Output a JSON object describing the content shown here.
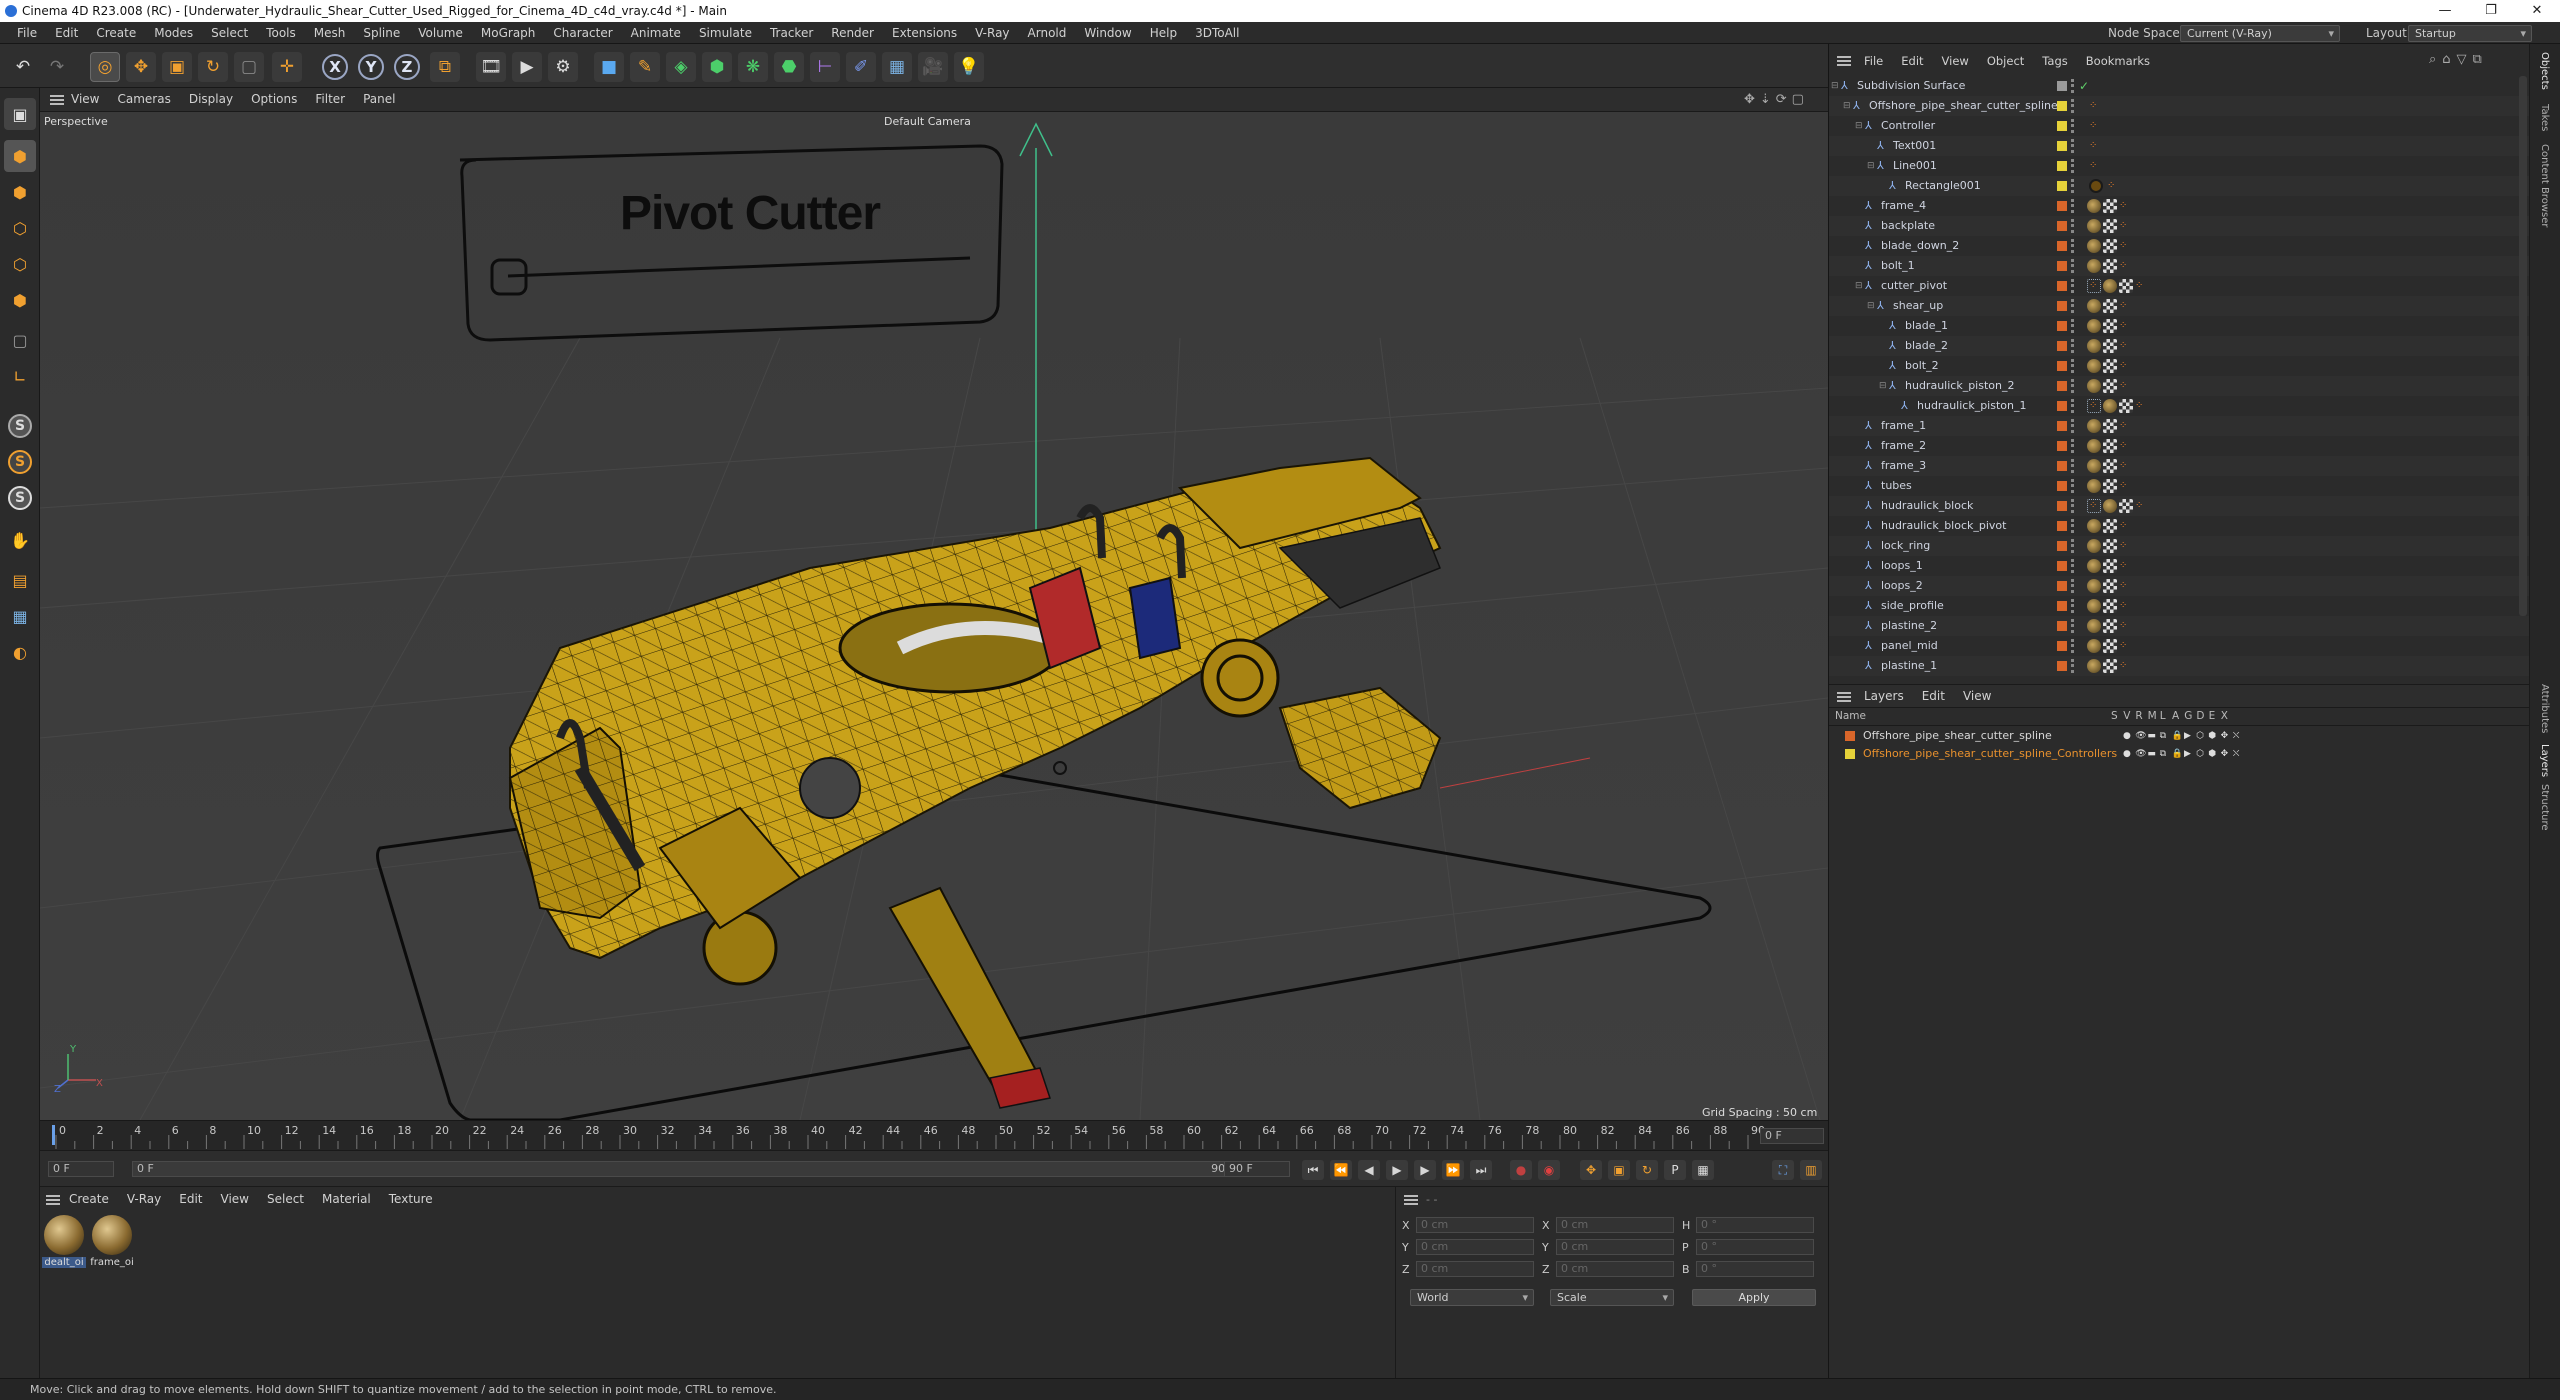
{
  "window": {
    "title": "Cinema 4D R23.008 (RC) - [Underwater_Hydraulic_Shear_Cutter_Used_Rigged_for_Cinema_4D_c4d_vray.c4d *] - Main"
  },
  "menubar": {
    "items": [
      "File",
      "Edit",
      "Create",
      "Modes",
      "Select",
      "Tools",
      "Mesh",
      "Spline",
      "Volume",
      "MoGraph",
      "Character",
      "Animate",
      "Simulate",
      "Tracker",
      "Render",
      "Extensions",
      "V-Ray",
      "Arnold",
      "Window",
      "Help",
      "3DToAll"
    ],
    "node_space_label": "Node Space:",
    "node_space_value": "Current (V-Ray)",
    "layout_label": "Layout:",
    "layout_value": "Startup"
  },
  "toolbar": {
    "axis_x": "X",
    "axis_y": "Y",
    "axis_z": "Z"
  },
  "viewport": {
    "menu": [
      "View",
      "Cameras",
      "Display",
      "Options",
      "Filter",
      "Panel"
    ],
    "projection": "Perspective",
    "camera": "Default Camera",
    "grid_spacing": "Grid Spacing : 50 cm",
    "overlay_text": "Pivot Cutter"
  },
  "timeline": {
    "ticks": [
      "0",
      "2",
      "4",
      "6",
      "8",
      "10",
      "12",
      "14",
      "16",
      "18",
      "20",
      "22",
      "24",
      "26",
      "28",
      "30",
      "32",
      "34",
      "36",
      "38",
      "40",
      "42",
      "44",
      "46",
      "48",
      "50",
      "52",
      "54",
      "56",
      "58",
      "60",
      "62",
      "64",
      "66",
      "68",
      "70",
      "72",
      "74",
      "76",
      "78",
      "80",
      "82",
      "84",
      "86",
      "88",
      "90"
    ],
    "current_frame": "0 F"
  },
  "transport": {
    "start_field": "0 F",
    "current_field": "0 F",
    "end_label": "90 F",
    "end_field": "90 F"
  },
  "materials": {
    "menu": [
      "Create",
      "V-Ray",
      "Edit",
      "View",
      "Select",
      "Material",
      "Texture"
    ],
    "items": [
      {
        "name": "dealt_oi"
      },
      {
        "name": "frame_oi"
      }
    ]
  },
  "coordinates": {
    "rows": [
      {
        "a": "X",
        "av": "0 cm",
        "b": "X",
        "bv": "0 cm",
        "c": "H",
        "cv": "0 °"
      },
      {
        "a": "Y",
        "av": "0 cm",
        "b": "Y",
        "bv": "0 cm",
        "c": "P",
        "cv": "0 °"
      },
      {
        "a": "Z",
        "av": "0 cm",
        "b": "Z",
        "bv": "0 cm",
        "c": "B",
        "cv": "0 °"
      }
    ],
    "world": "World",
    "scale": "Scale",
    "apply": "Apply"
  },
  "objects": {
    "menu": [
      "File",
      "Edit",
      "View",
      "Object",
      "Tags",
      "Bookmarks"
    ],
    "rows": [
      {
        "name": "Subdivision Surface",
        "level": 0,
        "color": "#9a9a9a",
        "tags": 0
      },
      {
        "name": "Offshore_pipe_shear_cutter_spline",
        "level": 1,
        "color": "#e6d23a",
        "tags": 1
      },
      {
        "name": "Controller",
        "level": 2,
        "color": "#e6d23a",
        "tags": 1
      },
      {
        "name": "Text001",
        "level": 3,
        "color": "#e6d23a",
        "tags": 1
      },
      {
        "name": "Line001",
        "level": 3,
        "color": "#e6d23a",
        "tags": 1
      },
      {
        "name": "Rectangle001",
        "level": 4,
        "color": "#e6d23a",
        "tags": 2
      },
      {
        "name": "frame_4",
        "level": 2,
        "color": "#d9662a",
        "tags": 3
      },
      {
        "name": "backplate",
        "level": 2,
        "color": "#d9662a",
        "tags": 3
      },
      {
        "name": "blade_down_2",
        "level": 2,
        "color": "#d9662a",
        "tags": 3
      },
      {
        "name": "bolt_1",
        "level": 2,
        "color": "#d9662a",
        "tags": 3
      },
      {
        "name": "cutter_pivot",
        "level": 2,
        "color": "#d9662a",
        "tags": 4
      },
      {
        "name": "shear_up",
        "level": 3,
        "color": "#d9662a",
        "tags": 3
      },
      {
        "name": "blade_1",
        "level": 4,
        "color": "#d9662a",
        "tags": 3
      },
      {
        "name": "blade_2",
        "level": 4,
        "color": "#d9662a",
        "tags": 3
      },
      {
        "name": "bolt_2",
        "level": 4,
        "color": "#d9662a",
        "tags": 3
      },
      {
        "name": "hudraulick_piston_2",
        "level": 4,
        "color": "#d9662a",
        "tags": 3
      },
      {
        "name": "hudraulick_piston_1",
        "level": 5,
        "color": "#d9662a",
        "tags": 4
      },
      {
        "name": "frame_1",
        "level": 2,
        "color": "#d9662a",
        "tags": 3
      },
      {
        "name": "frame_2",
        "level": 2,
        "color": "#d9662a",
        "tags": 3
      },
      {
        "name": "frame_3",
        "level": 2,
        "color": "#d9662a",
        "tags": 3
      },
      {
        "name": "tubes",
        "level": 2,
        "color": "#d9662a",
        "tags": 3
      },
      {
        "name": "hudraulick_block",
        "level": 2,
        "color": "#d9662a",
        "tags": 4
      },
      {
        "name": "hudraulick_block_pivot",
        "level": 2,
        "color": "#d9662a",
        "tags": 3
      },
      {
        "name": "lock_ring",
        "level": 2,
        "color": "#d9662a",
        "tags": 3
      },
      {
        "name": "loops_1",
        "level": 2,
        "color": "#d9662a",
        "tags": 3
      },
      {
        "name": "loops_2",
        "level": 2,
        "color": "#d9662a",
        "tags": 3
      },
      {
        "name": "side_profile",
        "level": 2,
        "color": "#d9662a",
        "tags": 3
      },
      {
        "name": "plastine_2",
        "level": 2,
        "color": "#d9662a",
        "tags": 3
      },
      {
        "name": "panel_mid",
        "level": 2,
        "color": "#d9662a",
        "tags": 3
      },
      {
        "name": "plastine_1",
        "level": 2,
        "color": "#d9662a",
        "tags": 3
      }
    ]
  },
  "layers": {
    "menu": [
      "Layers",
      "Edit",
      "View"
    ],
    "columns": [
      "Name",
      "S",
      "V",
      "R",
      "M",
      "L",
      "A",
      "G",
      "D",
      "E",
      "X"
    ],
    "rows": [
      {
        "name": "Offshore_pipe_shear_cutter_spline",
        "color": "#d9662a",
        "text": "#d8d8d8"
      },
      {
        "name": "Offshore_pipe_shear_cutter_spline_Controllers",
        "color": "#e6d23a",
        "text": "#e8912e"
      }
    ]
  },
  "side_tabs": [
    "Objects",
    "Takes",
    "Content Browser",
    "Attributes",
    "Layers",
    "Structure"
  ],
  "status": {
    "text": "Move: Click and drag to move elements. Hold down SHIFT to quantize movement / add to the selection in point mode, CTRL to remove."
  },
  "colors": {
    "accent": "#4a8de0",
    "yellow": "#e6d23a",
    "orange": "#d9662a"
  }
}
